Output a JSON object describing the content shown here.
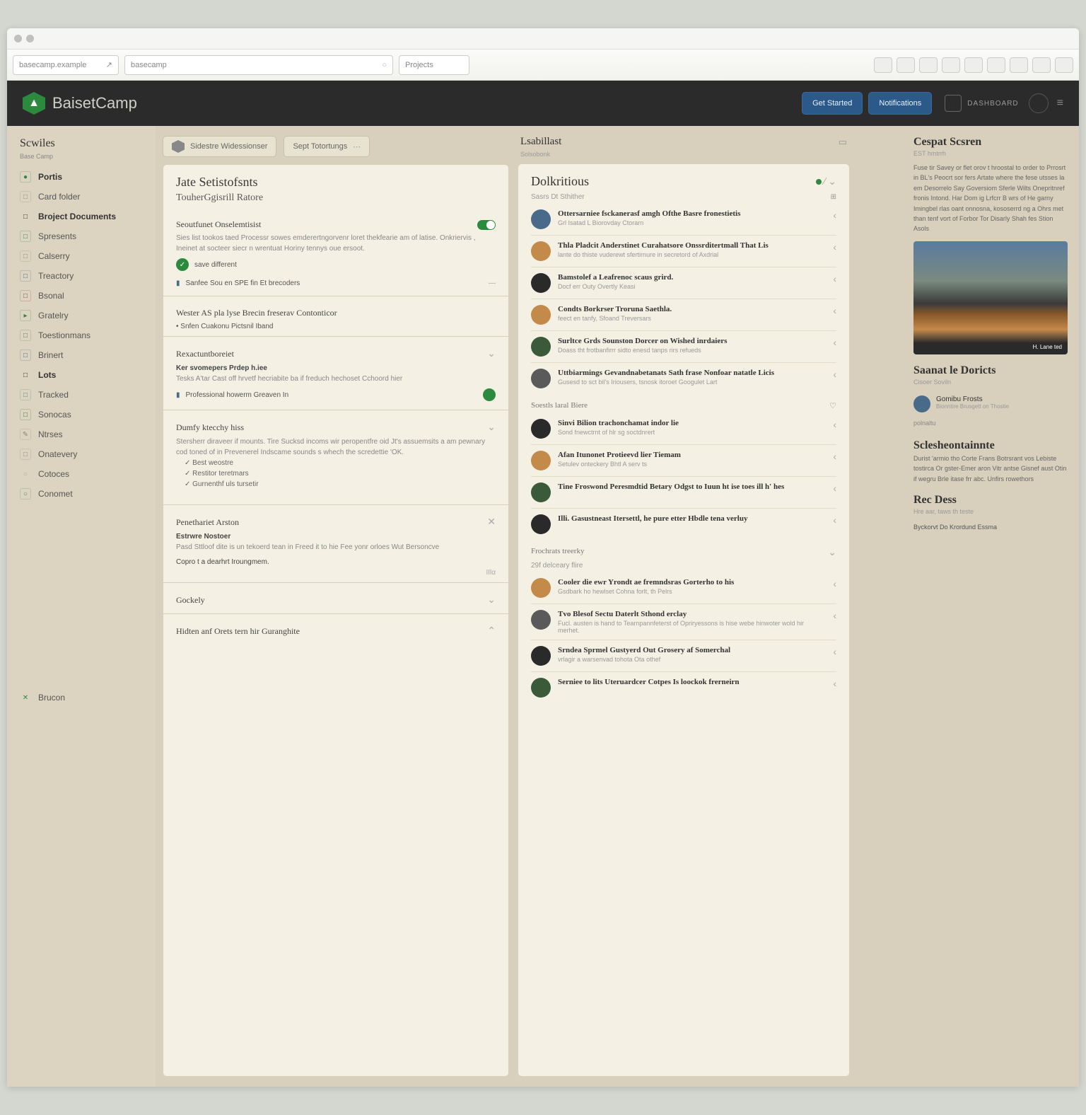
{
  "browser": {
    "addr1": "basecamp.example",
    "addr2": "basecamp",
    "addr3": "Projects"
  },
  "header": {
    "brand": "BaisetCamp",
    "btn1": "Get Started",
    "btn2": "Notifications",
    "label": "DASHBOARD"
  },
  "sidebar": {
    "title": "Scwiles",
    "sub": "Base Camp",
    "items": [
      {
        "ic": "●",
        "c": "#2b8a3e",
        "label": "Portis",
        "bold": true
      },
      {
        "ic": "□",
        "c": "#8a8a6a",
        "label": "Card folder"
      },
      {
        "ic": "□",
        "c": "#333",
        "label": "Broject Documents",
        "bold": true
      },
      {
        "ic": "□",
        "c": "#2b8a3e",
        "label": "Spresents"
      },
      {
        "ic": "□",
        "c": "#8a8a6a",
        "label": "Calserry"
      },
      {
        "ic": "□",
        "c": "#4a6a8a",
        "label": "Treactory"
      },
      {
        "ic": "□",
        "c": "#8a4a4a",
        "label": "Bsonal"
      },
      {
        "ic": "▸",
        "c": "#2b8a3e",
        "label": "Gratelry"
      },
      {
        "ic": "□",
        "c": "#5a7a5a",
        "label": "Toestionmans"
      },
      {
        "ic": "□",
        "c": "#4a6a8a",
        "label": "Brinert"
      },
      {
        "ic": "□",
        "c": "#333",
        "label": "Lots",
        "bold": true
      },
      {
        "ic": "□",
        "c": "#4a8a8a",
        "label": "Tracked"
      },
      {
        "ic": "□",
        "c": "#3a7a3a",
        "label": "Sonocas"
      },
      {
        "ic": "✎",
        "c": "#8a8a6a",
        "label": "Ntrses"
      },
      {
        "ic": "□",
        "c": "#8a8a8a",
        "label": "Onatevery"
      },
      {
        "ic": "○",
        "c": "#aaa",
        "label": "Cotoces"
      },
      {
        "ic": "○",
        "c": "#4a8a6a",
        "label": "Conomet"
      }
    ],
    "bottom": "Brucon"
  },
  "chips": {
    "a": "Sidestre Widessionser",
    "b": "Sept Totortungs"
  },
  "leftPanel": {
    "title": "Jate Setistofsnts",
    "subtitle": "TouherGgisrill Ratore",
    "sec1": {
      "title": "Seoutfunet Onselemtisist",
      "body": "Sies list tookos taed Processr sowes emderertngorvenr loret thekfearie am of latise. Onkriervis , Ineinet at socteer siecr n wrentuat Horiny tennys oue ersoot.",
      "pill1": "save different",
      "pill2": "Sanfee Sou en SPE fin Et brecoders"
    },
    "sec2": {
      "title": "Wester AS pla lyse Brecin freserav Contonticor",
      "sub": "Snfen Cuakonu Pictsnil Iband"
    },
    "sec3": {
      "title": "Rexactuntboreiet",
      "sub": "Ker svomepers Prdep h.iee",
      "body": "Tesks A'tar Cast off hrvetf hecriabite ba if freduch hechoset Cchoord hier",
      "link": "Professional howerm Greaven In"
    },
    "sec4": {
      "title": "Dumfy ktecchy hiss",
      "body": "Stersherr diraveer if mounts. Tire Sucksd incoms wir peropentfre oid Jt's assuemsits a am pewnary cod toned of in Prevenerel Indscame sounds s whech the scredettie 'OK.",
      "checks": [
        "Best weostre",
        "Restitor teretmars",
        "Gurnenthf uls tursetir"
      ]
    },
    "sec5": {
      "title": "Penethariet Arston",
      "sub": "Estrwre Nostoer",
      "body": "Pasd Sttloof dite is un tekoerd tean in Freed it to hie Fee yonr orloes Wut Bersoncve",
      "link": "Copro t a dearhrt Iroungmem."
    },
    "sec6": {
      "title": "Gockely"
    },
    "sec7": {
      "title": "Hidten anf Orets tern hir Guranghite"
    }
  },
  "midPanel": {
    "eyebrow": "Lsabillast",
    "eyesub": "Solsobonk",
    "title": "Dolkritious",
    "sub": "Sasrs Dt Sthither",
    "items1": [
      {
        "c": "#4a6a8a",
        "t": "Ottersarniee fsckanerasf amgh Ofthe Basre fronestietis",
        "d": "Grl Isatad L Biorovday Ctorarn"
      },
      {
        "c": "#c48a4a",
        "t": "Thla Pladcit Anderstinet Curahatsore Onssrditertmall That Lis",
        "d": "lante do thiste vuderewt sfertirnure in secretord of Axdrial"
      },
      {
        "c": "#2a2a2a",
        "t": "Bamstolef a Leafrenoc scaus grird.",
        "d": "Docf err Outy Overtly Keasi"
      },
      {
        "c": "#c48a4a",
        "t": "Condts Borkrser Troruna Saethla.",
        "d": "feect en tanfy, Sfoand Treversars"
      },
      {
        "c": "#3a5a3a",
        "t": "Surltce Grds Sounston Dorcer on Wished inrdaiers",
        "d": "Doass tht frotbanfirrr sidto enesd tanps rirs refueds"
      },
      {
        "c": "#5a5a5a",
        "t": "Uttbiarmings Gevandnabetanats Sath frase Nonfoar natatle Licis",
        "d": "Gusesd to sct bil's Iriousers, tsnosk itoroet Googulet Lart"
      }
    ],
    "group2": "Soestls laral Biere",
    "items2": [
      {
        "c": "#2a2a2a",
        "t": "Sinvi Bilion trachonchamat indor lie",
        "d": "Sond fnewctrnt of hlr sg soctdnrert"
      },
      {
        "c": "#c48a4a",
        "t": "Afan Itunonet Protieevd lier Tiemam",
        "d": "Setulev onteckery Bhtl A serv ts"
      },
      {
        "c": "#3a5a3a",
        "t": "Tine Froswond Peresmdtid Betary Odgst to Iuun ht ise toes ill h' hes",
        "d": ""
      },
      {
        "c": "#2a2a2a",
        "t": "Illi. Gasustneast Itersettl, he pure etter Hbdle tena verluy",
        "d": ""
      }
    ],
    "group3": "Frochrats treerky",
    "sub3": "29f delceary flire",
    "items3": [
      {
        "c": "#c48a4a",
        "t": "Cooler die ewr Yrondt ae fremndsras Gorterho to his",
        "d": "Gsdbark ho hewlset Cohna forlt, th Pelrs"
      },
      {
        "c": "#5a5a5a",
        "t": "Tvo Blesof Sectu Daterlt Sthond erclay",
        "d": "Fucl. austen is hand to Tearnpannfeterst of Opriryessons is hise webe hinwoter wold hir merhet."
      },
      {
        "c": "#2a2a2a",
        "t": "Srndea Sprmel Gustyerd Out Grosery af Somerchal",
        "d": "vrlagir a warsenvad tohota Ota othef"
      },
      {
        "c": "#3a5a3a",
        "t": "Serniee to lits Uteruardcer Cotpes Is loockok frerneirn",
        "d": ""
      }
    ]
  },
  "right": {
    "title": "Cespat Scsren",
    "sub": "EST hmtrrh",
    "para": "Fuse tir Savey or flet orov t hroostal to order to Prrosrt in BL's Peocrt sor fers Artate where the fese utsses la em Desorrelo Say Goversiom Sferle Wilts Onepritnref fronis Intond. Har Dom ig Lrfcrr B wrs of He garny Imingbel rlas oant onnosna, kososerrd ng a Ohrs met than tenf vort of Forbor Tor Disarly Shah fes Stion Asols",
    "imgcap": "H. Lane ted",
    "sec2": "Saanat le Doricts",
    "sub2": "Cisoer Soviln",
    "card": {
      "n": "Gomibu Frosts",
      "m": "Bionntire Brusgett on Thostie"
    },
    "label2": "polnaltu",
    "sec3": "Sclesheontainnte",
    "para3": "Durist 'armio tho Corte Frans Botrsrant vos Lebiste tostirca Or gster-Emer aron Vitr antse Gisnef aust Otin if wegru Brle itase frr abc. Unfirs rowethors",
    "sec4": "Rec Dess",
    "sub4": "Hre aar, taws th teste",
    "foot": "Byckorvt Do Krordund Essma"
  }
}
